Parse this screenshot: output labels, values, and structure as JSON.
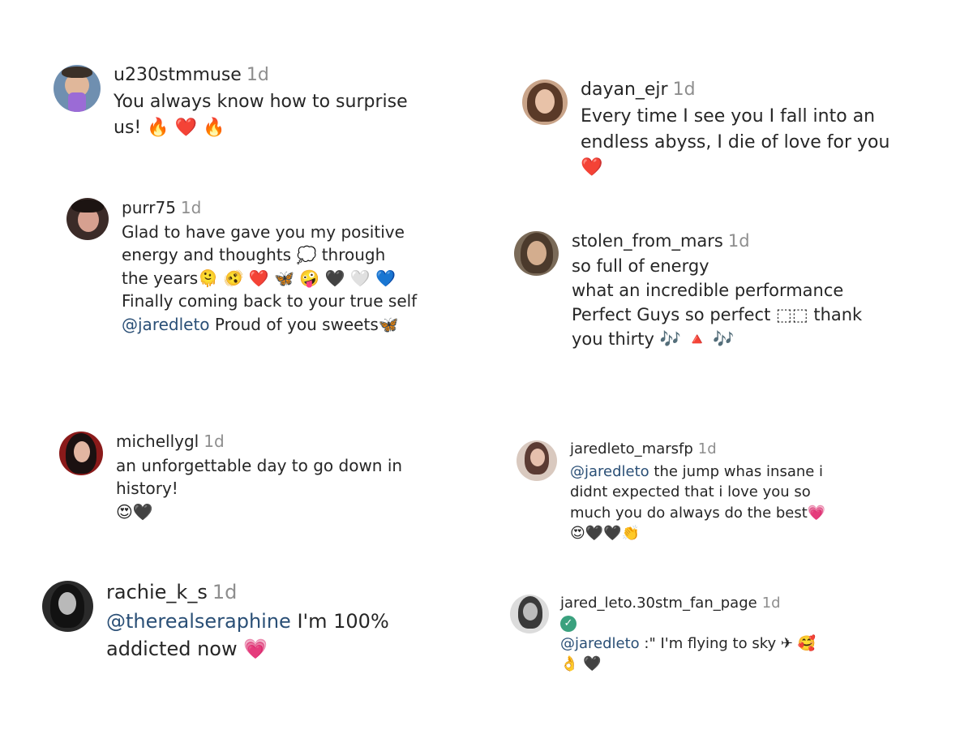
{
  "comments": [
    {
      "username": "u230stmmuse",
      "time": "1d",
      "lines": [
        {
          "text": "You always know how to surprise"
        },
        {
          "text": "us!",
          "emoji": "🔥 ❤️ 🔥"
        }
      ]
    },
    {
      "username": "dayan_ejr",
      "time": "1d",
      "lines": [
        {
          "text": "Every time I see you I fall into an"
        },
        {
          "text": "endless abyss, I die of love for you"
        },
        {
          "text": "",
          "emoji": "❤️"
        }
      ]
    },
    {
      "username": "purr75",
      "time": "1d",
      "lines": [
        {
          "text": "Glad to have gave you my positive"
        },
        {
          "text": "energy and thoughts",
          "emoji": "💭",
          "after": "through"
        },
        {
          "text": "the years",
          "emoji": "🫠 🫨 ❤️ 🦋 🤪 🖤 🤍 💙"
        },
        {
          "text": "Finally coming back to your true self"
        },
        {
          "mention": "@jaredleto",
          "text": "Proud of you sweets",
          "emoji": "🦋"
        }
      ]
    },
    {
      "username": "stolen_from_mars",
      "time": "1d",
      "lines": [
        {
          "text": "so full of energy"
        },
        {
          "text": "what an incredible performance"
        },
        {
          "text": "Perfect Guys so perfect ⬚⬚ thank"
        },
        {
          "text": "you thirty",
          "emoji": "🎶 🔺 🎶"
        }
      ]
    },
    {
      "username": "michellygl",
      "time": "1d",
      "lines": [
        {
          "text": "an unforgettable day to go down in"
        },
        {
          "text": "history!"
        },
        {
          "text": "",
          "emoji": "😍🖤"
        }
      ]
    },
    {
      "username": "jaredleto_marsfp",
      "time": "1d",
      "lines": [
        {
          "mention": "@jaredleto",
          "text": "the jump whas insane i"
        },
        {
          "text": "didnt expected that i love you so"
        },
        {
          "text": "much you do always do the best",
          "emoji": "💗"
        },
        {
          "text": "",
          "emoji": "😍🖤🖤👏"
        }
      ]
    },
    {
      "username": "rachie_k_s",
      "time": "1d",
      "lines": [
        {
          "mention": "@therealseraphine",
          "text": "I'm 100%"
        },
        {
          "text": "addicted now",
          "emoji": "💗"
        }
      ]
    },
    {
      "username": "jared_leto.30stm_fan_page",
      "time": "1d",
      "verified": "✓",
      "lines": [
        {
          "mention": "@jaredleto",
          "text": ":\" I'm flying to sky ✈",
          "emoji": "🥰"
        },
        {
          "text": "",
          "emoji": "👌 🖤"
        }
      ]
    }
  ]
}
